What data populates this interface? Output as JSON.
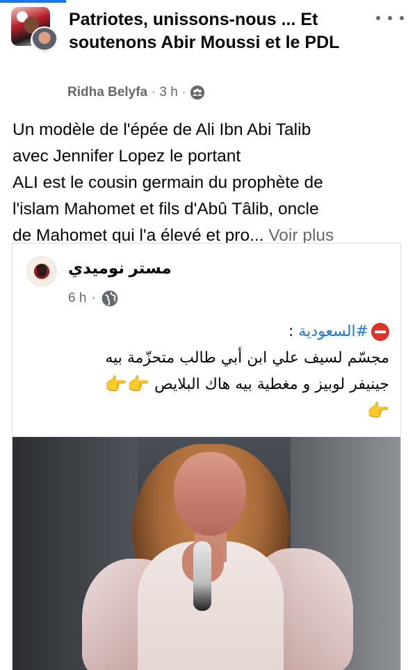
{
  "post": {
    "group_title": "Patriotes, unissons-nous ... Et soutenons Abir Moussi et le PDL",
    "author": "Ridha Belyfa",
    "separator": "·",
    "time": "3 h",
    "privacy_icon": "group-icon",
    "text_lines": [
      "Un modèle de l'épée de Ali Ibn Abi Talib",
      "avec Jennifer Lopez le portant",
      "ALI est le cousin germain du prophète de",
      "l'islam Mahomet et fils d'Abû Tâlib, oncle",
      "de Mahomet qui l'a élevé et pro..."
    ],
    "see_more": "Voir plus"
  },
  "shared": {
    "author": "مستر نوميدي",
    "time": "6 h",
    "separator": "·",
    "privacy_icon": "globe-icon",
    "hashtag": "#السعودية",
    "colon": ":",
    "line1": "مجسّم لسيف علي ابن أبي طالب متحزّمة بيه",
    "line2": "جينيفر لوبيز و مغطية بيه هاك البلايص",
    "emoji_pointing": "👉"
  },
  "colors": {
    "accent": "#1877f2",
    "hashtag": "#1b74e4",
    "secondary_text": "#65676b"
  }
}
